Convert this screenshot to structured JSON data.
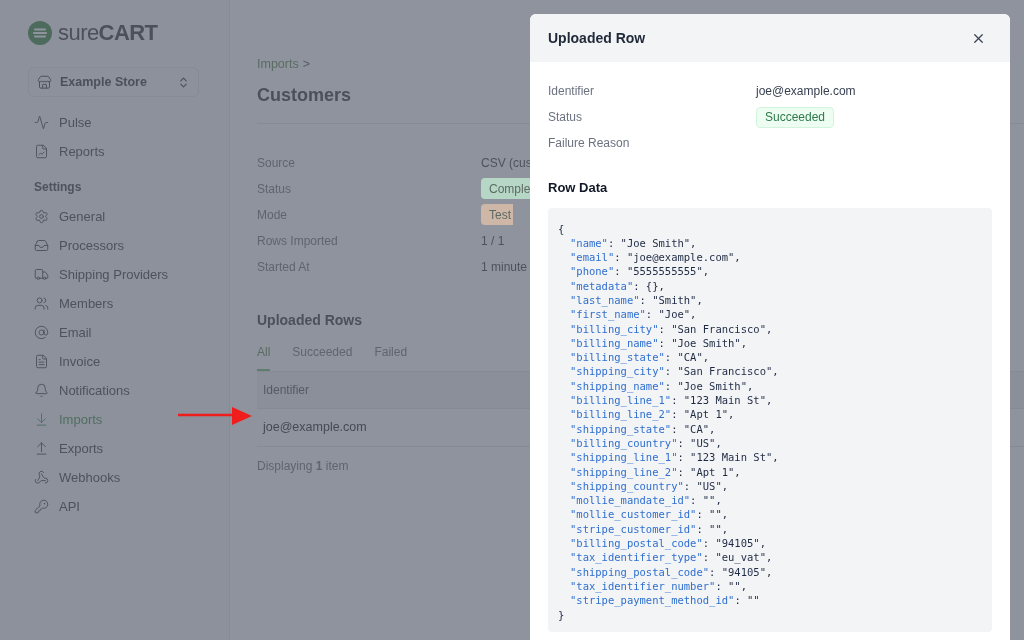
{
  "logo": {
    "text": "sure**CART**"
  },
  "store_switcher": {
    "label": "Example Store"
  },
  "sidebar": {
    "top_items": [
      {
        "label": "Pulse",
        "selected": false
      },
      {
        "label": "Reports",
        "selected": false
      }
    ],
    "section_title": "Settings",
    "settings_items": [
      {
        "label": "General",
        "selected": false
      },
      {
        "label": "Processors",
        "selected": false
      },
      {
        "label": "Shipping Providers",
        "selected": false
      },
      {
        "label": "Members",
        "selected": false
      },
      {
        "label": "Email",
        "selected": false
      },
      {
        "label": "Invoice",
        "selected": false
      },
      {
        "label": "Notifications",
        "selected": false
      },
      {
        "label": "Imports",
        "selected": true
      },
      {
        "label": "Exports",
        "selected": false
      },
      {
        "label": "Webhooks",
        "selected": false
      },
      {
        "label": "API",
        "selected": false
      }
    ]
  },
  "breadcrumb": {
    "parent": "Imports",
    "separator": ">"
  },
  "page_title": "Customers",
  "details": [
    {
      "label": "Source",
      "value": "CSV (cus",
      "kind": "text"
    },
    {
      "label": "Status",
      "value": "Comple",
      "kind": "badge",
      "color": "#b6d6c6"
    },
    {
      "label": "Mode",
      "value": "Test",
      "kind": "badge",
      "color": "#cfb7a8"
    },
    {
      "label": "Rows Imported",
      "value": "1 / 1",
      "kind": "text"
    },
    {
      "label": "Started At",
      "value": "1 minute",
      "kind": "text"
    }
  ],
  "uploaded_rows": {
    "title": "Uploaded Rows",
    "tabs": [
      {
        "label": "All",
        "selected": true
      },
      {
        "label": "Succeeded",
        "selected": false
      },
      {
        "label": "Failed",
        "selected": false
      }
    ],
    "column": "Identifier",
    "rows": [
      "joe@example.com"
    ],
    "footer": "Displaying **1** item"
  },
  "modal": {
    "title": "Uploaded Row",
    "fields": [
      {
        "label": "Identifier",
        "value": "joe@example.com",
        "kind": "text"
      },
      {
        "label": "Status",
        "value": "Succeeded",
        "kind": "badge"
      },
      {
        "label": "Failure Reason",
        "kind": "empty"
      }
    ],
    "row_data_title": "Row Data",
    "open": "{",
    "entries": [
      {
        "key": "\"name\"",
        "value": ": \"Joe Smith\","
      },
      {
        "key": "\"email\"",
        "value": ": \"joe@example.com\","
      },
      {
        "key": "\"phone\"",
        "value": ": \"5555555555\","
      },
      {
        "key": "\"metadata\"",
        "value": ": {},"
      },
      {
        "key": "\"last_name\"",
        "value": ": \"Smith\","
      },
      {
        "key": "\"first_name\"",
        "value": ": \"Joe\","
      },
      {
        "key": "\"billing_city\"",
        "value": ": \"San Francisco\","
      },
      {
        "key": "\"billing_name\"",
        "value": ": \"Joe Smith\","
      },
      {
        "key": "\"billing_state\"",
        "value": ": \"CA\","
      },
      {
        "key": "\"shipping_city\"",
        "value": ": \"San Francisco\","
      },
      {
        "key": "\"shipping_name\"",
        "value": ": \"Joe Smith\","
      },
      {
        "key": "\"billing_line_1\"",
        "value": ": \"123 Main St\","
      },
      {
        "key": "\"billing_line_2\"",
        "value": ": \"Apt 1\","
      },
      {
        "key": "\"shipping_state\"",
        "value": ": \"CA\","
      },
      {
        "key": "\"billing_country\"",
        "value": ": \"US\","
      },
      {
        "key": "\"shipping_line_1\"",
        "value": ": \"123 Main St\","
      },
      {
        "key": "\"shipping_line_2\"",
        "value": ": \"Apt 1\","
      },
      {
        "key": "\"shipping_country\"",
        "value": ": \"US\","
      },
      {
        "key": "\"mollie_mandate_id\"",
        "value": ": \"\","
      },
      {
        "key": "\"mollie_customer_id\"",
        "value": ": \"\","
      },
      {
        "key": "\"stripe_customer_id\"",
        "value": ": \"\","
      },
      {
        "key": "\"billing_postal_code\"",
        "value": ": \"94105\","
      },
      {
        "key": "\"tax_identifier_type\"",
        "value": ": \"eu_vat\","
      },
      {
        "key": "\"shipping_postal_code\"",
        "value": ": \"94105\","
      },
      {
        "key": "\"tax_identifier_number\"",
        "value": ": \"\","
      },
      {
        "key": "\"stripe_payment_method_id\"",
        "value": ": \"\""
      }
    ],
    "close": "}"
  }
}
